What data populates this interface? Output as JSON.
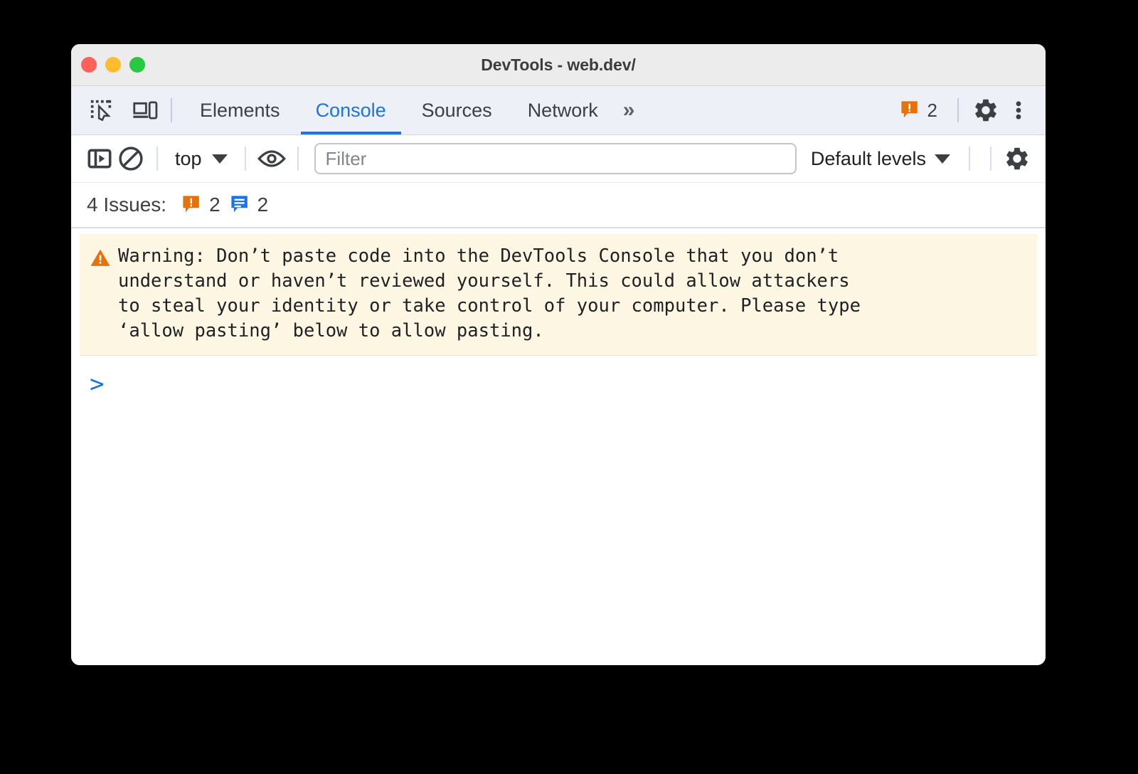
{
  "window": {
    "title": "DevTools - web.dev/",
    "traffic_lights": [
      {
        "name": "close",
        "color": "#ff6159"
      },
      {
        "name": "minimize",
        "color": "#febc2e"
      },
      {
        "name": "zoom",
        "color": "#28c840"
      }
    ]
  },
  "tabbar": {
    "inspect_icon": "inspect-element-icon",
    "device_icon": "device-toolbar-icon",
    "tabs": [
      {
        "label": "Elements",
        "active": false
      },
      {
        "label": "Console",
        "active": true
      },
      {
        "label": "Sources",
        "active": false
      },
      {
        "label": "Network",
        "active": false
      }
    ],
    "more_tabs": "»",
    "error_count": "2",
    "settings_icon": "gear-icon",
    "more_options_icon": "kebab-menu-icon"
  },
  "console_toolbar": {
    "sidebar_toggle_icon": "console-sidebar-icon",
    "clear_console_icon": "clear-console-icon",
    "context": "top",
    "eye_icon": "live-expression-eye-icon",
    "filter_placeholder": "Filter",
    "filter_value": "",
    "levels": "Default levels",
    "settings_icon": "gear-icon"
  },
  "issues_bar": {
    "label": "4 Issues:",
    "error_count": "2",
    "info_count": "2"
  },
  "console": {
    "warning": {
      "icon": "warning-triangle-icon",
      "text": "Warning: Don’t paste code into the DevTools Console that you don’t\nunderstand or haven’t reviewed yourself. This could allow attackers\nto steal your identity or take control of your computer. Please type\n‘allow pasting’ below to allow pasting."
    },
    "prompt_symbol": ">",
    "prompt_value": ""
  },
  "colors": {
    "accent_blue": "#1a73e8",
    "error_orange": "#e8710a",
    "warning_bg": "#fdf6e3",
    "tabbar_bg": "#eef0f7",
    "titlebar_bg": "#ececec"
  }
}
